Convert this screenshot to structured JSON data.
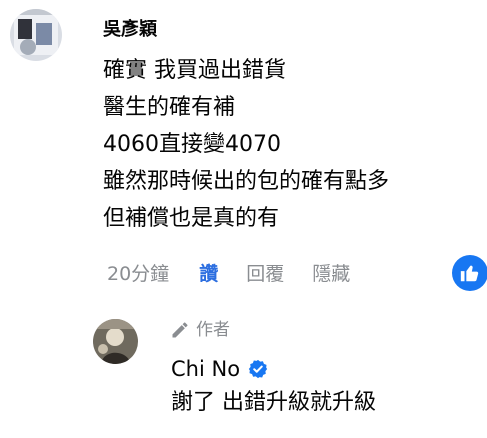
{
  "comment": {
    "author": "吳彥穎",
    "avatar_icon": "user-avatar-icon",
    "lines": [
      "確實 我買過出錯貨",
      "醫生的確有補",
      "4060直接變4070",
      "雖然那時候出的包的確有點多",
      "但補償也是真的有"
    ],
    "actions": {
      "time": "20分鐘",
      "like": "讚",
      "reply": "回覆",
      "hide": "隱藏"
    },
    "reaction_icon": "thumbs-up-icon",
    "like_color": "#1877f2"
  },
  "reply": {
    "tag_icon": "pencil-icon",
    "tag": "作者",
    "author": "Chi No",
    "verified_icon": "verified-badge-icon",
    "text": "謝了 出錯升級就升級"
  }
}
